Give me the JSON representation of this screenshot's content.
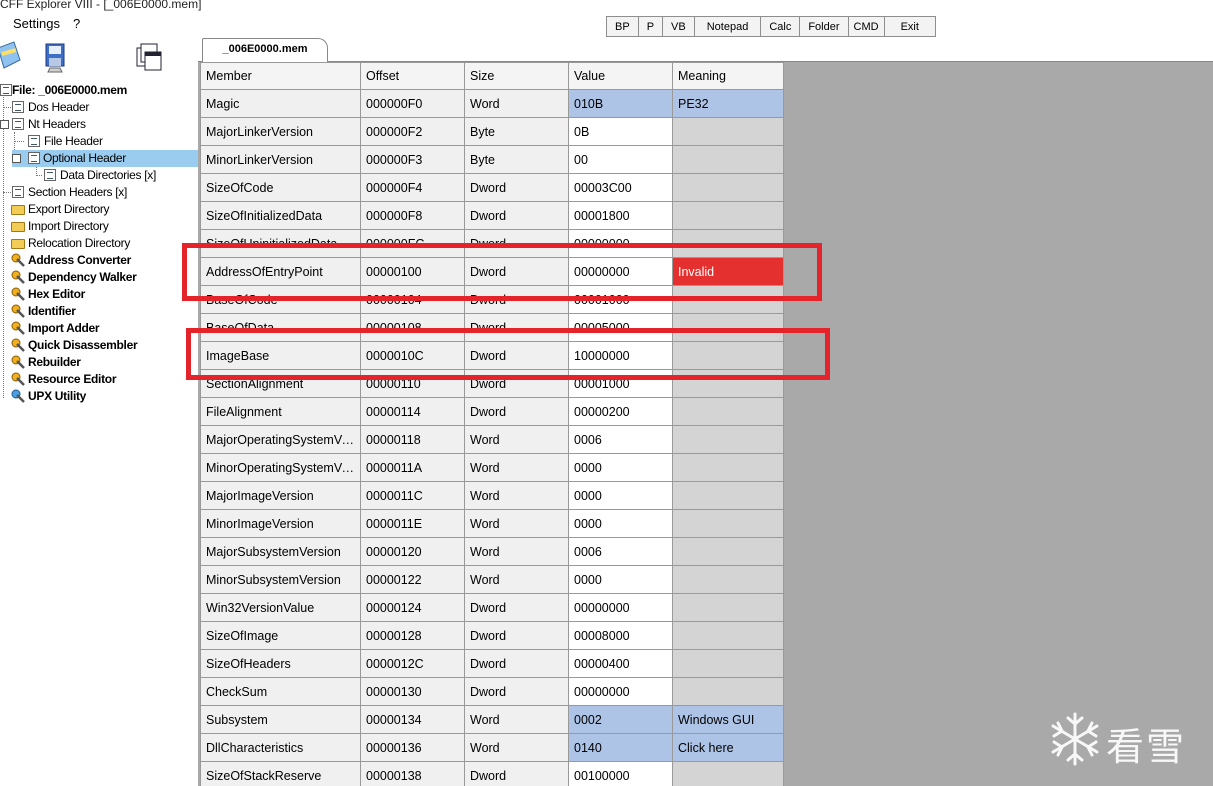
{
  "window": {
    "title": "CFF Explorer VIII - [_006E0000.mem]"
  },
  "menu": [
    {
      "label": "Settings"
    },
    {
      "label": "?"
    }
  ],
  "toolbar": [
    {
      "label": "BP"
    },
    {
      "label": "P"
    },
    {
      "label": "VB"
    },
    {
      "label": "Notepad"
    },
    {
      "label": "Calc"
    },
    {
      "label": "Folder"
    },
    {
      "label": "CMD"
    },
    {
      "label": "Exit"
    }
  ],
  "tab": {
    "label": "_006E0000.mem"
  },
  "tree": [
    {
      "label": "File: _006E0000.mem",
      "icon": "file-icon",
      "bold": true
    },
    {
      "label": "Dos Header",
      "icon": "document-icon"
    },
    {
      "label": "Nt Headers",
      "icon": "document-icon"
    },
    {
      "label": "File Header",
      "icon": "document-icon"
    },
    {
      "label": "Optional Header",
      "icon": "document-icon",
      "selected": true
    },
    {
      "label": "Data Directories [x]",
      "icon": "document-icon"
    },
    {
      "label": "Section Headers [x]",
      "icon": "document-icon"
    },
    {
      "label": "Export Directory",
      "icon": "folder-icon"
    },
    {
      "label": "Import Directory",
      "icon": "folder-icon"
    },
    {
      "label": "Relocation Directory",
      "icon": "folder-icon"
    },
    {
      "label": "Address Converter",
      "icon": "tool-icon",
      "bold": true
    },
    {
      "label": "Dependency Walker",
      "icon": "tool-icon",
      "bold": true
    },
    {
      "label": "Hex Editor",
      "icon": "tool-icon",
      "bold": true
    },
    {
      "label": "Identifier",
      "icon": "tool-icon",
      "bold": true
    },
    {
      "label": "Import Adder",
      "icon": "tool-icon",
      "bold": true
    },
    {
      "label": "Quick Disassembler",
      "icon": "tool-icon",
      "bold": true
    },
    {
      "label": "Rebuilder",
      "icon": "tool-icon",
      "bold": true
    },
    {
      "label": "Resource Editor",
      "icon": "tool-icon",
      "bold": true
    },
    {
      "label": "UPX Utility",
      "icon": "tool-icon",
      "bold": true
    }
  ],
  "table": {
    "columns": [
      "Member",
      "Offset",
      "Size",
      "Value",
      "Meaning"
    ],
    "rows": [
      [
        "Magic",
        "000000F0",
        "Word",
        "010B",
        "PE32"
      ],
      [
        "MajorLinkerVersion",
        "000000F2",
        "Byte",
        "0B",
        ""
      ],
      [
        "MinorLinkerVersion",
        "000000F3",
        "Byte",
        "00",
        ""
      ],
      [
        "SizeOfCode",
        "000000F4",
        "Dword",
        "00003C00",
        ""
      ],
      [
        "SizeOfInitializedData",
        "000000F8",
        "Dword",
        "00001800",
        ""
      ],
      [
        "SizeOfUninitializedData",
        "000000FC",
        "Dword",
        "00000000",
        ""
      ],
      [
        "AddressOfEntryPoint",
        "00000100",
        "Dword",
        "00000000",
        "Invalid"
      ],
      [
        "BaseOfCode",
        "00000104",
        "Dword",
        "00001000",
        ""
      ],
      [
        "BaseOfData",
        "00000108",
        "Dword",
        "00005000",
        ""
      ],
      [
        "ImageBase",
        "0000010C",
        "Dword",
        "10000000",
        ""
      ],
      [
        "SectionAlignment",
        "00000110",
        "Dword",
        "00001000",
        ""
      ],
      [
        "FileAlignment",
        "00000114",
        "Dword",
        "00000200",
        ""
      ],
      [
        "MajorOperatingSystemVersion",
        "00000118",
        "Word",
        "0006",
        ""
      ],
      [
        "MinorOperatingSystemVersion",
        "0000011A",
        "Word",
        "0000",
        ""
      ],
      [
        "MajorImageVersion",
        "0000011C",
        "Word",
        "0000",
        ""
      ],
      [
        "MinorImageVersion",
        "0000011E",
        "Word",
        "0000",
        ""
      ],
      [
        "MajorSubsystemVersion",
        "00000120",
        "Word",
        "0006",
        ""
      ],
      [
        "MinorSubsystemVersion",
        "00000122",
        "Word",
        "0000",
        ""
      ],
      [
        "Win32VersionValue",
        "00000124",
        "Dword",
        "00000000",
        ""
      ],
      [
        "SizeOfImage",
        "00000128",
        "Dword",
        "00008000",
        ""
      ],
      [
        "SizeOfHeaders",
        "0000012C",
        "Dword",
        "00000400",
        ""
      ],
      [
        "CheckSum",
        "00000130",
        "Dword",
        "00000000",
        ""
      ],
      [
        "Subsystem",
        "00000134",
        "Word",
        "0002",
        "Windows GUI"
      ],
      [
        "DllCharacteristics",
        "00000136",
        "Word",
        "0140",
        "Click here"
      ],
      [
        "SizeOfStackReserve",
        "00000138",
        "Dword",
        "00100000",
        ""
      ]
    ]
  },
  "highlight_colors": {
    "blue": "#aec4e6",
    "red": "#e53030",
    "annotation": "#e5232a"
  },
  "watermark": {
    "text": "看雪",
    "icon": "snowflake-icon"
  }
}
